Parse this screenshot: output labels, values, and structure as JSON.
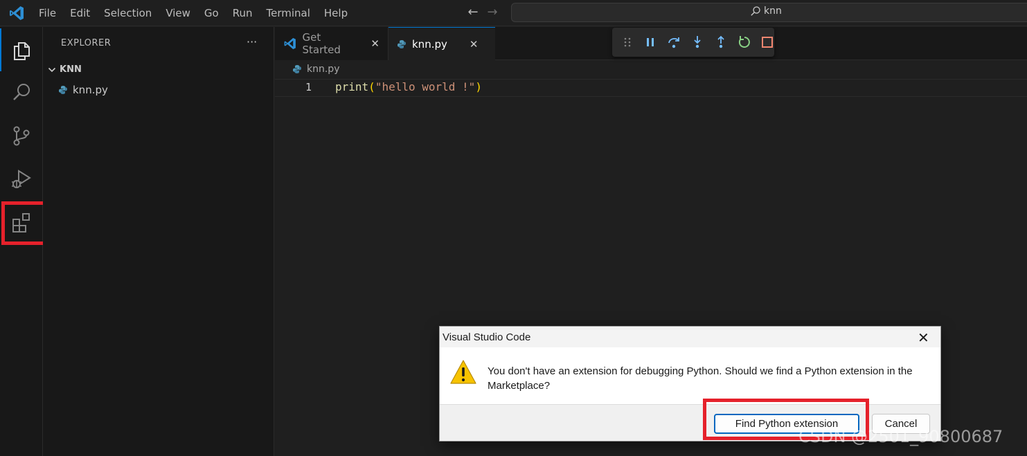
{
  "titlebar": {
    "menu": [
      "File",
      "Edit",
      "Selection",
      "View",
      "Go",
      "Run",
      "Terminal",
      "Help"
    ],
    "search_text": "knn"
  },
  "activity_bar": {
    "items": [
      "explorer-icon",
      "search-icon",
      "source-control-icon",
      "run-debug-icon",
      "extensions-icon"
    ]
  },
  "sidebar": {
    "title": "EXPLORER",
    "more": "···",
    "folder": "KNN",
    "files": [
      {
        "name": "knn.py"
      }
    ]
  },
  "tabs": [
    {
      "label": "Get Started",
      "close": "✕"
    },
    {
      "label": "knn.py",
      "close": "✕"
    }
  ],
  "editor": {
    "breadcrumb": "knn.py",
    "line_number": "1",
    "code": {
      "fn": "print",
      "open": "(",
      "str": "\"hello world !\"",
      "close": ")"
    }
  },
  "dialog": {
    "title": "Visual Studio Code",
    "close": "✕",
    "message": "You don't have an extension for debugging Python. Should we find a Python extension in the Marketplace?",
    "primary_button": "Find Python extension",
    "secondary_button": "Cancel"
  },
  "watermark": "CSDN @2501_90800687",
  "colors": {
    "accent": "#0078d4",
    "highlight_red": "#e5212b",
    "python_icon": "#519aba",
    "warning": "#f7c300"
  }
}
